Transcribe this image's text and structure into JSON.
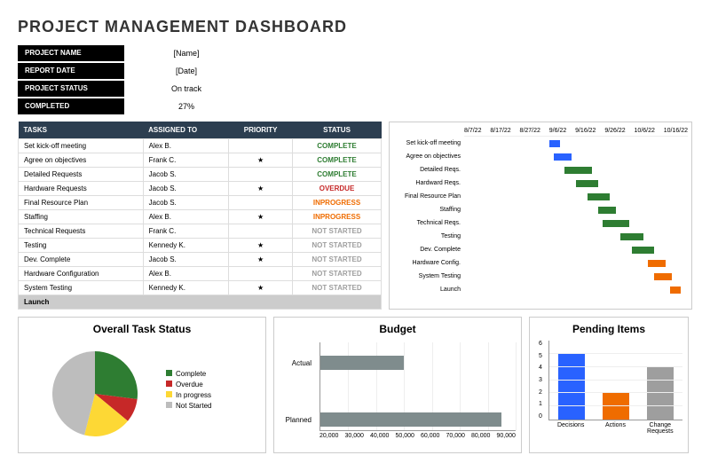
{
  "title": "PROJECT MANAGEMENT DASHBOARD",
  "header": {
    "project_name_label": "PROJECT NAME",
    "project_name_value": "[Name]",
    "report_date_label": "REPORT DATE",
    "report_date_value": "[Date]",
    "project_status_label": "PROJECT STATUS",
    "project_status_value": "On track",
    "completed_label": "COMPLETED",
    "completed_value": "27%"
  },
  "tasks_table": {
    "headers": {
      "tasks": "TASKS",
      "assigned": "ASSIGNED TO",
      "priority": "PRIORITY",
      "status": "STATUS"
    },
    "rows": [
      {
        "task": "Set kick-off meeting",
        "assigned": "Alex B.",
        "priority": "",
        "status": "COMPLETE",
        "status_class": "complete"
      },
      {
        "task": "Agree on objectives",
        "assigned": "Frank C.",
        "priority": "★",
        "status": "COMPLETE",
        "status_class": "complete"
      },
      {
        "task": "Detailed Requests",
        "assigned": "Jacob S.",
        "priority": "",
        "status": "COMPLETE",
        "status_class": "complete"
      },
      {
        "task": "Hardware Requests",
        "assigned": "Jacob S.",
        "priority": "★",
        "status": "OVERDUE",
        "status_class": "overdue"
      },
      {
        "task": "Final Resource Plan",
        "assigned": "Jacob S.",
        "priority": "",
        "status": "INPROGRESS",
        "status_class": "inprogress"
      },
      {
        "task": "Staffing",
        "assigned": "Alex B.",
        "priority": "★",
        "status": "INPROGRESS",
        "status_class": "inprogress"
      },
      {
        "task": "Technical Requests",
        "assigned": "Frank C.",
        "priority": "",
        "status": "NOT STARTED",
        "status_class": "notstarted"
      },
      {
        "task": "Testing",
        "assigned": "Kennedy K.",
        "priority": "★",
        "status": "NOT STARTED",
        "status_class": "notstarted"
      },
      {
        "task": "Dev. Complete",
        "assigned": "Jacob S.",
        "priority": "★",
        "status": "NOT STARTED",
        "status_class": "notstarted"
      },
      {
        "task": "Hardware Configuration",
        "assigned": "Alex B.",
        "priority": "",
        "status": "NOT STARTED",
        "status_class": "notstarted"
      },
      {
        "task": "System Testing",
        "assigned": "Kennedy K.",
        "priority": "★",
        "status": "NOT STARTED",
        "status_class": "notstarted"
      }
    ],
    "launch_row": "Launch"
  },
  "gantt": {
    "dates": [
      "8/7/22",
      "8/17/22",
      "8/27/22",
      "9/6/22",
      "9/16/22",
      "9/26/22",
      "10/6/22",
      "10/16/22"
    ],
    "rows": [
      {
        "task": "Set kick-off meeting",
        "left": 38,
        "width": 5,
        "color": "#2962ff"
      },
      {
        "task": "Agree on objectives",
        "left": 40,
        "width": 8,
        "color": "#2962ff"
      },
      {
        "task": "Detailed Reqs.",
        "left": 45,
        "width": 12,
        "color": "#2e7d32"
      },
      {
        "task": "Hardward Reqs.",
        "left": 50,
        "width": 10,
        "color": "#2e7d32"
      },
      {
        "task": "Final Resource Plan",
        "left": 55,
        "width": 10,
        "color": "#2e7d32"
      },
      {
        "task": "Staffing",
        "left": 60,
        "width": 8,
        "color": "#2e7d32"
      },
      {
        "task": "Technical Reqs.",
        "left": 62,
        "width": 12,
        "color": "#2e7d32"
      },
      {
        "task": "Testing",
        "left": 70,
        "width": 10,
        "color": "#2e7d32"
      },
      {
        "task": "Dev. Complete",
        "left": 75,
        "width": 10,
        "color": "#2e7d32"
      },
      {
        "task": "Hardware Config.",
        "left": 82,
        "width": 8,
        "color": "#ef6c00"
      },
      {
        "task": "System Testing",
        "left": 85,
        "width": 8,
        "color": "#ef6c00"
      },
      {
        "task": "Launch",
        "left": 92,
        "width": 5,
        "color": "#ef6c00"
      }
    ]
  },
  "chart_data": [
    {
      "type": "pie",
      "title": "Overall Task Status",
      "series": [
        {
          "name": "Complete",
          "value": 27,
          "color": "#2e7d32"
        },
        {
          "name": "Overdue",
          "value": 9,
          "color": "#c62828"
        },
        {
          "name": "In progress",
          "value": 18,
          "color": "#fdd835"
        },
        {
          "name": "Not Started",
          "value": 46,
          "color": "#bdbdbd"
        }
      ]
    },
    {
      "type": "bar",
      "title": "Budget",
      "orientation": "horizontal",
      "categories": [
        "Actual",
        "Planned"
      ],
      "values": [
        50000,
        85000
      ],
      "xlim": [
        20000,
        90000
      ],
      "xticks": [
        20000,
        30000,
        40000,
        50000,
        60000,
        70000,
        80000,
        90000
      ]
    },
    {
      "type": "bar",
      "title": "Pending Items",
      "categories": [
        "Decisions",
        "Actions",
        "Change Requests"
      ],
      "values": [
        5,
        2,
        4
      ],
      "colors": [
        "#2962ff",
        "#ef6c00",
        "#9e9e9e"
      ],
      "ylim": [
        0,
        6
      ],
      "yticks": [
        0,
        1,
        2,
        3,
        4,
        5,
        6
      ]
    }
  ]
}
